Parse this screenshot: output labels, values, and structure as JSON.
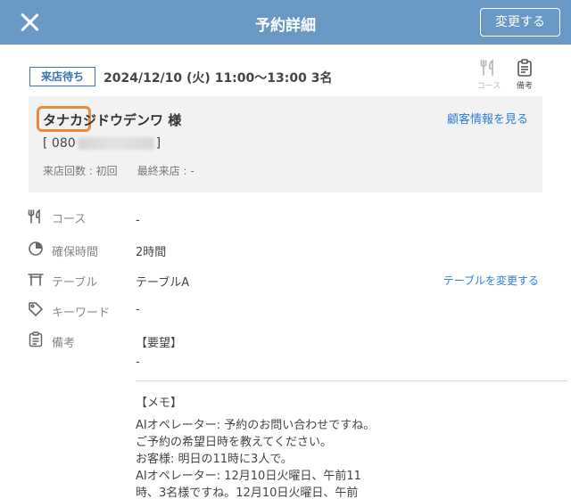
{
  "header": {
    "title": "予約詳細",
    "change_button": "変更する"
  },
  "reservation": {
    "status": "来店待ち",
    "datetime": "2024/12/10 (火) 11:00〜13:00 3名"
  },
  "top_icons": {
    "course_label": "コース",
    "memo_label": "備考"
  },
  "customer": {
    "name_highlight": "タナカ",
    "name_rest": "ジドウデンワ 様",
    "view_link": "顧客情報を見る",
    "phone_open": "[ 080",
    "phone_close": "]",
    "visit_count": "来店回数 : 初回",
    "last_visit": "最終来店 : -"
  },
  "details": {
    "course_label": "コース",
    "course_value": "-",
    "duration_label": "確保時間",
    "duration_value": "2時間",
    "table_label": "テーブル",
    "table_value": "テーブルA",
    "table_change_link": "テーブルを変更する",
    "keyword_label": "キーワード",
    "keyword_value": "-",
    "notes_label": "備考",
    "request_heading": "【要望】",
    "request_value": "-",
    "memo_heading": "【メモ】",
    "memo_lines": [
      "AIオペレーター: 予約のお問い合わせですね。",
      "ご予約の希望日時を教えてください。",
      "お客様: 明日の11時に3人で。",
      "AIオペレーター: 12月10日火曜日、午前11",
      "時、3名様ですね。12月10日火曜日、午前"
    ]
  },
  "colors": {
    "header_bg": "#6a98c4",
    "accent_blue": "#3b73b3",
    "link_blue": "#2f7ed6",
    "highlight_orange": "#ec8a3c"
  }
}
